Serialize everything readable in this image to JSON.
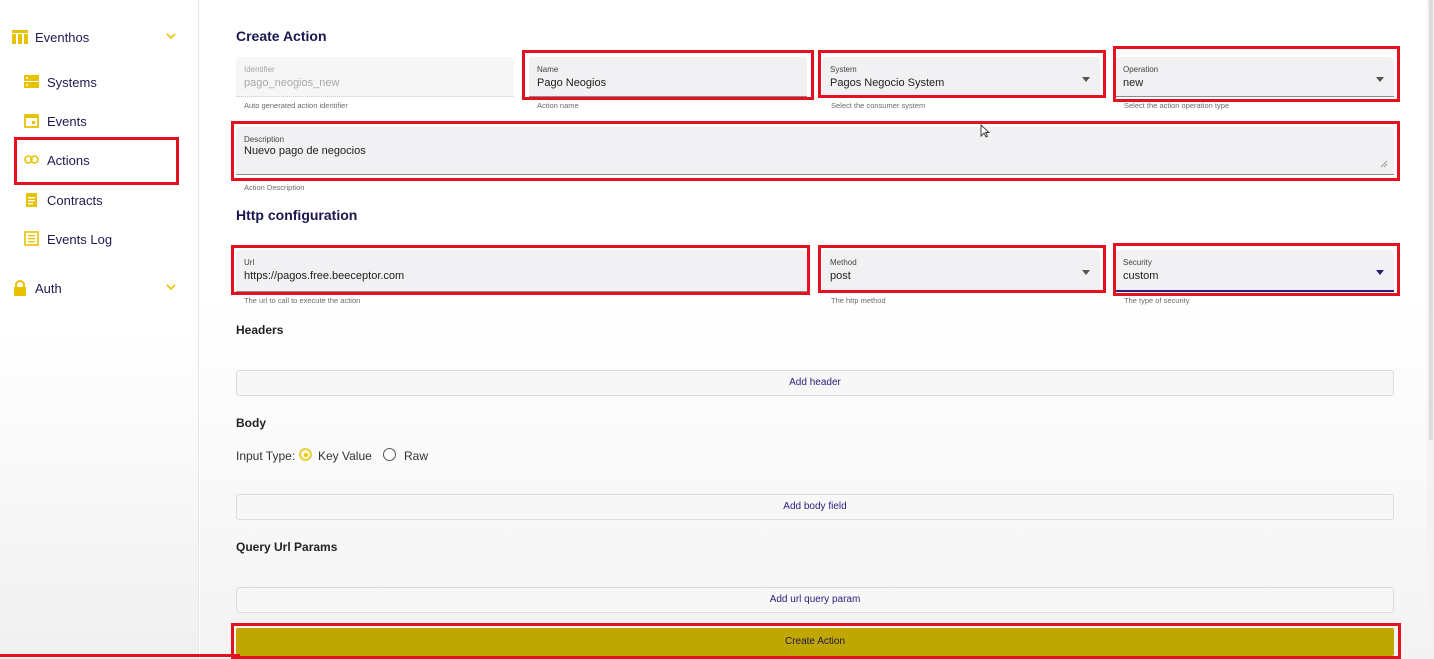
{
  "sidebar": {
    "groups": [
      {
        "label": "Eventhos",
        "icon": "table-icon"
      },
      {
        "label": "Auth",
        "icon": "lock-icon"
      }
    ],
    "items": [
      {
        "label": "Systems",
        "icon": "server-icon"
      },
      {
        "label": "Events",
        "icon": "calendar-icon"
      },
      {
        "label": "Actions",
        "icon": "link-icon"
      },
      {
        "label": "Contracts",
        "icon": "clipboard-icon"
      },
      {
        "label": "Events Log",
        "icon": "list-icon"
      }
    ]
  },
  "form": {
    "title": "Create Action",
    "identifier": {
      "label": "Identifier",
      "value": "pago_neogios_new",
      "helper": "Auto generated action identifier"
    },
    "name": {
      "label": "Name",
      "value": "Pago Neogios",
      "helper": "Action name"
    },
    "system": {
      "label": "System",
      "value": "Pagos Negocio System",
      "helper": "Select the consumer system"
    },
    "operation": {
      "label": "Operation",
      "value": "new",
      "helper": "Select the action operation type"
    },
    "description": {
      "label": "Description",
      "value": "Nuevo pago de negocios",
      "helper": "Action Description"
    },
    "http_title": "Http configuration",
    "url": {
      "label": "Url",
      "value": "https://pagos.free.beeceptor.com",
      "helper": "The url to call to execute the action"
    },
    "method": {
      "label": "Method",
      "value": "post",
      "helper": "The http method"
    },
    "security": {
      "label": "Security",
      "value": "custom",
      "helper": "The type of security"
    },
    "headers_title": "Headers",
    "add_header": "Add header",
    "body_title": "Body",
    "input_type_label": "Input Type:",
    "input_type_options": [
      "Key Value",
      "Raw"
    ],
    "input_type_selected": "Key Value",
    "add_body_field": "Add body field",
    "query_title": "Query Url Params",
    "add_query_param": "Add url query param",
    "create_button": "Create Action"
  },
  "colors": {
    "accent": "#c0a700",
    "highlight": "#e3121e",
    "primary_text": "#1a1650"
  }
}
